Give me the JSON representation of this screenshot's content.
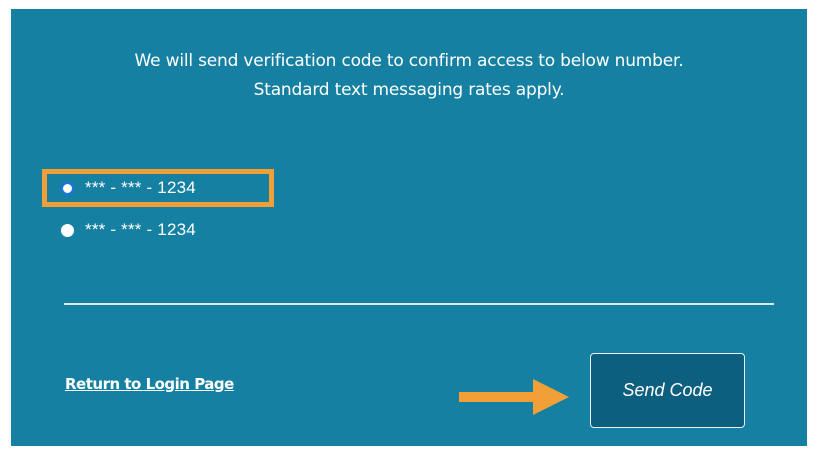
{
  "intro": {
    "line1": "We will send verification code to confirm access to below number.",
    "line2": "Standard text messaging rates apply."
  },
  "phone_options": [
    {
      "label": "*** - *** - 1234",
      "selected": true
    },
    {
      "label": "*** - *** - 1234",
      "selected": false
    }
  ],
  "footer": {
    "return_link": "Return to Login Page",
    "send_button": "Send Code"
  },
  "colors": {
    "panel_background": "#1580a2",
    "highlight": "#f0a037",
    "button_background": "#0d5f7f",
    "radio_selected": "#1a73e8"
  },
  "icons": {
    "annotation_arrow": "arrow-right-icon"
  }
}
